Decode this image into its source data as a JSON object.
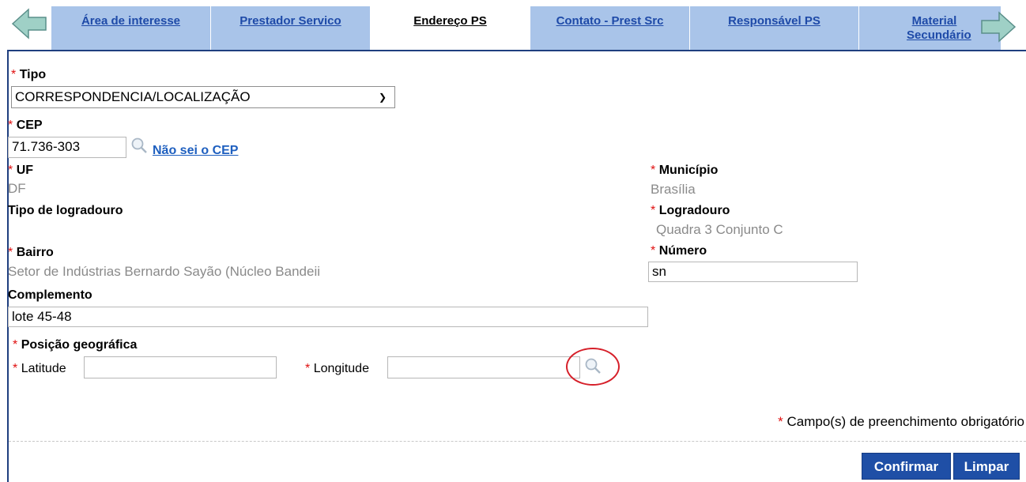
{
  "tabs": [
    {
      "label": "Área de interesse"
    },
    {
      "label": "Prestador Servico"
    },
    {
      "label": "Endereço PS"
    },
    {
      "label": "Contato - Prest Src"
    },
    {
      "label": "Responsável PS"
    },
    {
      "label": "Material Secundário"
    }
  ],
  "required_mark": "*",
  "form": {
    "tipo": {
      "label": "Tipo",
      "value": "CORRESPONDENCIA/LOCALIZAÇÃO"
    },
    "cep": {
      "label": "CEP",
      "value": "71.736-303",
      "link": "Não sei o CEP"
    },
    "uf": {
      "label": "UF",
      "value": "DF"
    },
    "municipio": {
      "label": "Município",
      "value": "Brasília"
    },
    "tipo_logradouro": {
      "label": "Tipo de logradouro",
      "value": ""
    },
    "logradouro": {
      "label": "Logradouro",
      "value": "Quadra 3 Conjunto C"
    },
    "bairro": {
      "label": "Bairro",
      "value": "Setor de Indústrias Bernardo Sayão (Núcleo Bandeii"
    },
    "numero": {
      "label": "Número",
      "value": "sn"
    },
    "complemento": {
      "label": "Complemento",
      "value": "lote 45-48"
    },
    "posicao": {
      "label": "Posição geográfica"
    },
    "latitude": {
      "label": "Latitude",
      "value": ""
    },
    "longitude": {
      "label": "Longitude",
      "value": ""
    }
  },
  "footer": {
    "required_note": "Campo(s) de preenchimento obrigatório",
    "confirm_label": "Confirmar",
    "clear_label": "Limpar"
  },
  "colors": {
    "accent": "#1f4fa6",
    "tab": "#a9c4e9",
    "required": "#e01010",
    "highlight": "#d6202a"
  }
}
